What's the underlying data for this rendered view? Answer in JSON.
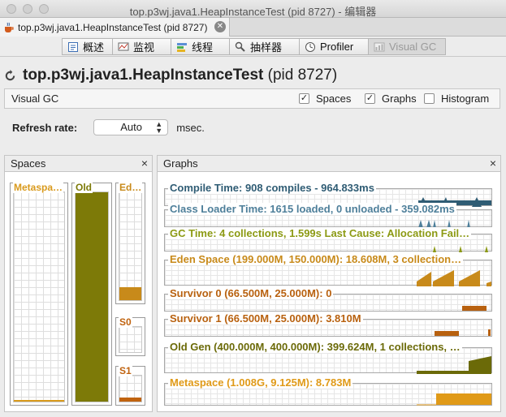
{
  "window": {
    "title": "top.p3wj.java1.HeapInstanceTest (pid 8727) - 编辑器"
  },
  "doc_tab": {
    "label": "top.p3wj.java1.HeapInstanceTest (pid 8727)",
    "close_glyph": "✕"
  },
  "view_tabs": [
    {
      "label": "概述",
      "icon": "overview-icon"
    },
    {
      "label": "监视",
      "icon": "monitor-icon"
    },
    {
      "label": "线程",
      "icon": "threads-icon"
    },
    {
      "label": "抽样器",
      "icon": "sampler-icon"
    },
    {
      "label": "Profiler",
      "icon": "profiler-icon"
    },
    {
      "label": "Visual GC",
      "icon": "visualgc-icon"
    }
  ],
  "header": {
    "app": "top.p3wj.java1.HeapInstanceTest",
    "pid": "(pid 8727)"
  },
  "options": {
    "title": "Visual GC",
    "spaces": {
      "label": "Spaces",
      "checked": true
    },
    "graphs": {
      "label": "Graphs",
      "checked": true
    },
    "histogram": {
      "label": "Histogram",
      "checked": false
    }
  },
  "refresh": {
    "label": "Refresh rate:",
    "value": "Auto",
    "unit": "msec."
  },
  "spaces_panel": {
    "title": "Spaces",
    "close": "×",
    "columns": [
      {
        "name": "Metaspace",
        "label": "Metaspa…",
        "fill": 0.005,
        "color": "#d99a1d"
      },
      {
        "name": "Old",
        "label": "Old",
        "fill": 1.0,
        "color": "#7d7a08"
      },
      {
        "name": "Eden",
        "label": "Ed…",
        "fill": 0.12,
        "color": "#c88a1a"
      },
      {
        "name": "S0",
        "label": "S0",
        "fill": 0.0,
        "color": "#c0630f"
      },
      {
        "name": "S1",
        "label": "S1",
        "fill": 0.15,
        "color": "#c0630f"
      }
    ]
  },
  "graphs_panel": {
    "title": "Graphs",
    "close": "×",
    "rows": [
      {
        "name": "compile-time",
        "label": "Compile Time: 908 compiles - 964.833ms",
        "color": "#2f5c74"
      },
      {
        "name": "class-loader",
        "label": "Class Loader Time: 1615 loaded, 0 unloaded - 359.082ms",
        "color": "#4e7f9a"
      },
      {
        "name": "gc-time",
        "label": "GC Time: 4 collections, 1.599s  Last Cause: Allocation Fail…",
        "color": "#8c9a14"
      },
      {
        "name": "eden-space",
        "label": "Eden Space (199.000M, 150.000M): 18.608M, 3 collection…",
        "color": "#c88a1a"
      },
      {
        "name": "survivor-0",
        "label": "Survivor 0 (66.500M, 25.000M): 0",
        "color": "#b8610f"
      },
      {
        "name": "survivor-1",
        "label": "Survivor 1 (66.500M, 25.000M): 3.810M",
        "color": "#b8610f"
      },
      {
        "name": "old-gen",
        "label": "Old Gen (400.000M, 400.000M): 399.624M, 1 collections, …",
        "color": "#6b6a08"
      },
      {
        "name": "metaspace",
        "label": "Metaspace (1.008G, 9.125M): 8.783M",
        "color": "#e09a18"
      }
    ]
  }
}
